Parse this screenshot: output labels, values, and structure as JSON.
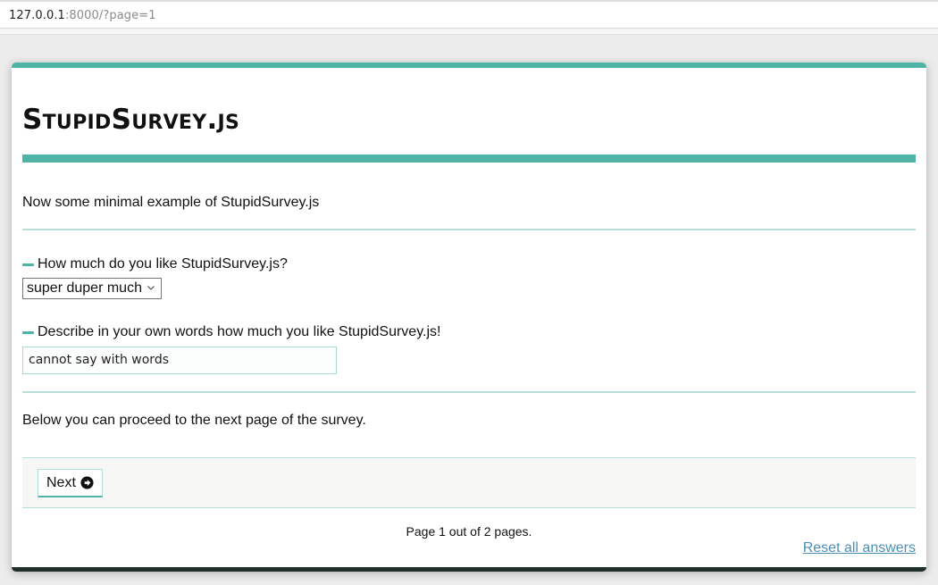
{
  "browser": {
    "url_host": "127.0.0.1",
    "url_rest": ":8000/?page=1"
  },
  "survey": {
    "title": "StupidSurvey.js",
    "intro": "Now some minimal example of StupidSurvey.js",
    "questions": [
      {
        "label": "How much do you like StupidSurvey.js?",
        "type": "select",
        "selected": "super duper much"
      },
      {
        "label": "Describe in your own words how much you like StupidSurvey.js!",
        "type": "text",
        "value": "cannot say with words"
      }
    ],
    "proceed_text": "Below you can proceed to the next page of the survey.",
    "next_label": "Next",
    "page_info": "Page 1 out of 2 pages.",
    "reset_label": "Reset all answers"
  },
  "colors": {
    "accent": "#4fb3a6",
    "footer_bar": "#1f2f2c",
    "link": "#4c8fb6"
  },
  "icons": {
    "next": "arrow-circle-right-icon",
    "select": "chevron-down-icon"
  }
}
